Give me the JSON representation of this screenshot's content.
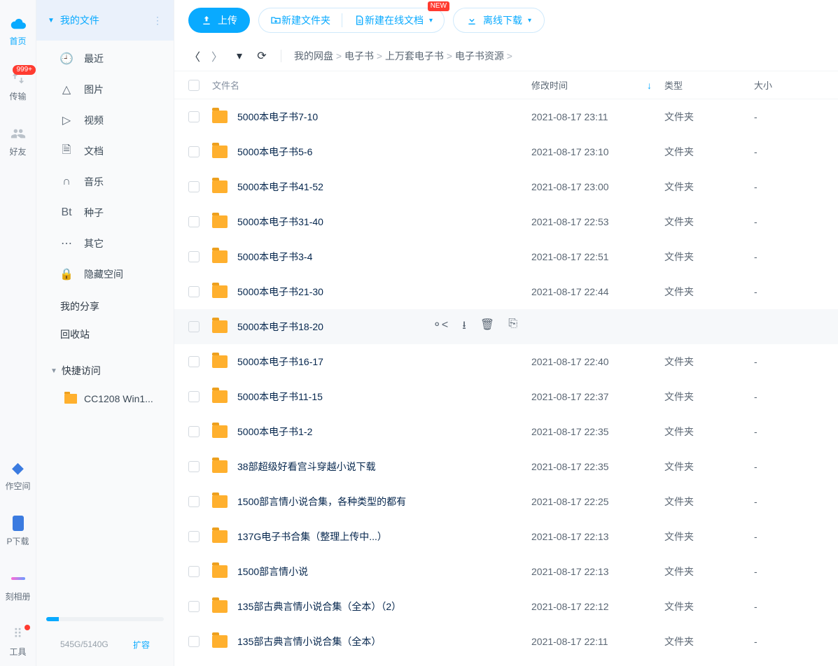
{
  "vnav": {
    "home": "首页",
    "transfer": "传输",
    "friends": "好友",
    "badge": "999+",
    "workspace": "作空间",
    "pdownload": "P下载",
    "album": "刻相册",
    "tools": "工具"
  },
  "sidebar": {
    "myfiles": "我的文件",
    "items": [
      {
        "label": "最近"
      },
      {
        "label": "图片"
      },
      {
        "label": "视频"
      },
      {
        "label": "文档"
      },
      {
        "label": "音乐"
      },
      {
        "label": "种子"
      },
      {
        "label": "其它"
      },
      {
        "label": "隐藏空间"
      }
    ],
    "myshare": "我的分享",
    "recycle": "回收站",
    "quick": "快捷访问",
    "quick_item": "CC1208 Win1...",
    "storage": "545G/5140G",
    "expand": "扩容"
  },
  "toolbar": {
    "upload": "上传",
    "newfolder": "新建文件夹",
    "newdoc": "新建在线文档",
    "newtag": "NEW",
    "offline": "离线下载"
  },
  "breadcrumb": {
    "items": [
      "我的网盘",
      "电子书",
      "上万套电子书",
      "电子书资源"
    ]
  },
  "table": {
    "head": {
      "name": "文件名",
      "date": "修改时间",
      "type": "类型",
      "size": "大小"
    },
    "rows": [
      {
        "name": "5000本电子书7-10",
        "date": "2021-08-17 23:11",
        "type": "文件夹",
        "size": "-"
      },
      {
        "name": "5000本电子书5-6",
        "date": "2021-08-17 23:10",
        "type": "文件夹",
        "size": "-"
      },
      {
        "name": "5000本电子书41-52",
        "date": "2021-08-17 23:00",
        "type": "文件夹",
        "size": "-"
      },
      {
        "name": "5000本电子书31-40",
        "date": "2021-08-17 22:53",
        "type": "文件夹",
        "size": "-"
      },
      {
        "name": "5000本电子书3-4",
        "date": "2021-08-17 22:51",
        "type": "文件夹",
        "size": "-"
      },
      {
        "name": "5000本电子书21-30",
        "date": "2021-08-17 22:44",
        "type": "文件夹",
        "size": "-"
      },
      {
        "name": "5000本电子书18-20",
        "date": "",
        "type": "",
        "size": "",
        "hover": true
      },
      {
        "name": "5000本电子书16-17",
        "date": "2021-08-17 22:40",
        "type": "文件夹",
        "size": "-"
      },
      {
        "name": "5000本电子书11-15",
        "date": "2021-08-17 22:37",
        "type": "文件夹",
        "size": "-"
      },
      {
        "name": "5000本电子书1-2",
        "date": "2021-08-17 22:35",
        "type": "文件夹",
        "size": "-"
      },
      {
        "name": "38部超级好看宫斗穿越小说下载",
        "date": "2021-08-17 22:35",
        "type": "文件夹",
        "size": "-"
      },
      {
        "name": "1500部言情小说合集，各种类型的都有",
        "date": "2021-08-17 22:25",
        "type": "文件夹",
        "size": "-"
      },
      {
        "name": "137G电子书合集（整理上传中...）",
        "date": "2021-08-17 22:13",
        "type": "文件夹",
        "size": "-"
      },
      {
        "name": "1500部言情小说",
        "date": "2021-08-17 22:13",
        "type": "文件夹",
        "size": "-"
      },
      {
        "name": "135部古典言情小说合集（全本）（2）",
        "date": "2021-08-17 22:12",
        "type": "文件夹",
        "size": "-"
      },
      {
        "name": "135部古典言情小说合集（全本）",
        "date": "2021-08-17 22:11",
        "type": "文件夹",
        "size": "-"
      }
    ]
  }
}
